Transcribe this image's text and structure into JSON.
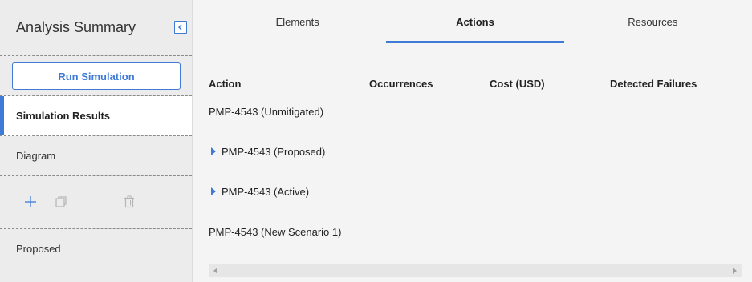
{
  "sidebar": {
    "title": "Analysis Summary",
    "collapse_icon": "chevron-left-icon",
    "run_button": "Run Simulation",
    "items": [
      {
        "label": "Simulation Results",
        "active": true
      },
      {
        "label": "Diagram",
        "active": false
      }
    ],
    "tools": [
      {
        "icon": "add-icon"
      },
      {
        "icon": "copy-icon"
      },
      {
        "icon": "delete-icon"
      }
    ],
    "scenario_label": "Proposed"
  },
  "tabs": [
    {
      "label": "Elements",
      "active": false
    },
    {
      "label": "Actions",
      "active": true
    },
    {
      "label": "Resources",
      "active": false
    }
  ],
  "table": {
    "columns": [
      "Action",
      "Occurrences",
      "Cost (USD)",
      "Detected Failures"
    ],
    "rows": [
      {
        "action": "PMP-4543 (Unmitigated)",
        "expandable": false
      },
      {
        "action": "PMP-4543 (Proposed)",
        "expandable": true
      },
      {
        "action": "PMP-4543 (Active)",
        "expandable": true
      },
      {
        "action": "PMP-4543 (New Scenario 1)",
        "expandable": false
      }
    ]
  },
  "colors": {
    "accent": "#3f7bd6",
    "sidebar_bg": "#ececec",
    "main_bg": "#f4f4f4"
  }
}
